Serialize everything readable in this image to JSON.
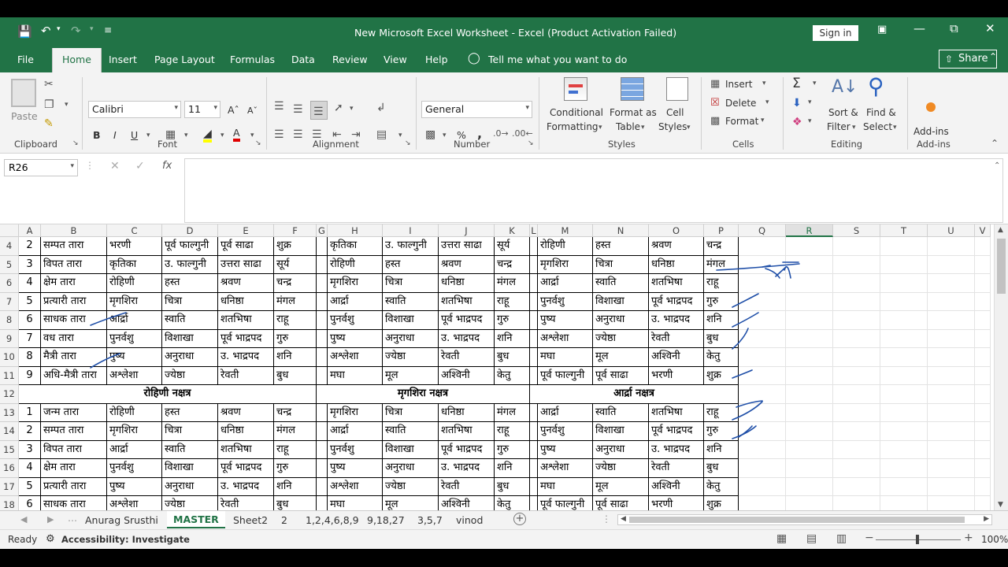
{
  "titlebar": {
    "title": "New Microsoft Excel Worksheet  -  Excel (Product Activation Failed)",
    "signin": "Sign in"
  },
  "tabs": [
    "File",
    "Home",
    "Insert",
    "Page Layout",
    "Formulas",
    "Data",
    "Review",
    "View",
    "Help"
  ],
  "tell_me": "Tell me what you want to do",
  "share": "Share",
  "ribbon": {
    "clipboard": {
      "paste": "Paste",
      "label": "Clipboard"
    },
    "font": {
      "name": "Calibri",
      "size": "11",
      "label": "Font",
      "bold": "B",
      "italic": "I",
      "underline": "U"
    },
    "alignment": {
      "label": "Alignment"
    },
    "number": {
      "format": "General",
      "label": "Number",
      "percent": "%",
      "comma": ","
    },
    "styles": {
      "conditional1": "Conditional",
      "conditional2": "Formatting",
      "format_as1": "Format as",
      "format_as2": "Table",
      "cell_styles1": "Cell",
      "cell_styles2": "Styles",
      "label": "Styles"
    },
    "cells": {
      "insert": "Insert",
      "delete": "Delete",
      "format": "Format",
      "label": "Cells"
    },
    "editing": {
      "sort1": "Sort &",
      "sort2": "Filter",
      "find1": "Find &",
      "find2": "Select",
      "label": "Editing"
    },
    "addins": {
      "button": "Add-ins",
      "label": "Add-ins"
    }
  },
  "namebox": "R26",
  "fx": "fx",
  "columns": [
    {
      "name": "A",
      "w": 28
    },
    {
      "name": "B",
      "w": 84
    },
    {
      "name": "C",
      "w": 70
    },
    {
      "name": "D",
      "w": 71
    },
    {
      "name": "E",
      "w": 71
    },
    {
      "name": "F",
      "w": 54
    },
    {
      "name": "G",
      "w": 14
    },
    {
      "name": "H",
      "w": 70
    },
    {
      "name": "I",
      "w": 71
    },
    {
      "name": "J",
      "w": 71
    },
    {
      "name": "K",
      "w": 45
    },
    {
      "name": "L",
      "w": 10
    },
    {
      "name": "M",
      "w": 70
    },
    {
      "name": "N",
      "w": 71
    },
    {
      "name": "O",
      "w": 70
    },
    {
      "name": "P",
      "w": 44
    },
    {
      "name": "Q",
      "w": 60
    },
    {
      "name": "R",
      "w": 60
    },
    {
      "name": "S",
      "w": 60
    },
    {
      "name": "T",
      "w": 60
    },
    {
      "name": "U",
      "w": 60
    },
    {
      "name": "V",
      "w": 20
    }
  ],
  "selected_column": "R",
  "rows": [
    {
      "n": "4",
      "type": "data",
      "cells": [
        "2",
        "सम्पत तारा",
        "भरणी",
        "पूर्व फाल्गुनी",
        "पूर्व साढा",
        "शुक्र",
        "",
        "कृतिका",
        "उ. फाल्गुनी",
        "उत्तरा साढा",
        "सूर्य",
        "",
        "रोहिणी",
        "हस्त",
        "श्रवण",
        "चन्द्र"
      ]
    },
    {
      "n": "5",
      "type": "data",
      "cells": [
        "3",
        "विपत तारा",
        "कृतिका",
        "उ. फाल्गुनी",
        "उत्तरा साढा",
        "सूर्य",
        "",
        "रोहिणी",
        "हस्त",
        "श्रवण",
        "चन्द्र",
        "",
        "मृगशिरा",
        "चित्रा",
        "धनिष्ठा",
        "मंगल"
      ]
    },
    {
      "n": "6",
      "type": "data",
      "cells": [
        "4",
        "क्षेम तारा",
        "रोहिणी",
        "हस्त",
        "श्रवण",
        "चन्द्र",
        "",
        "मृगशिरा",
        "चित्रा",
        "धनिष्ठा",
        "मंगल",
        "",
        "आर्द्रा",
        "स्वाति",
        "शतभिषा",
        "राहू"
      ]
    },
    {
      "n": "7",
      "type": "data",
      "cells": [
        "5",
        "प्रत्यारी तारा",
        "मृगशिरा",
        "चित्रा",
        "धनिष्ठा",
        "मंगल",
        "",
        "आर्द्रा",
        "स्वाति",
        "शतभिषा",
        "राहू",
        "",
        "पुनर्वशु",
        "विशाखा",
        "पूर्व भाद्रपद",
        "गुरु"
      ]
    },
    {
      "n": "8",
      "type": "data",
      "cells": [
        "6",
        "साधक तारा",
        "आर्द्रा",
        "स्वाति",
        "शतभिषा",
        "राहू",
        "",
        "पुनर्वशु",
        "विशाखा",
        "पूर्व भाद्रपद",
        "गुरु",
        "",
        "पुष्य",
        "अनुराधा",
        "उ. भाद्रपद",
        "शनि"
      ]
    },
    {
      "n": "9",
      "type": "data",
      "cells": [
        "7",
        "वध  तारा",
        "पुनर्वशु",
        "विशाखा",
        "पूर्व भाद्रपद",
        "गुरु",
        "",
        "पुष्य",
        "अनुराधा",
        "उ. भाद्रपद",
        "शनि",
        "",
        "अश्लेशा",
        "ज्येष्ठा",
        "रेवती",
        "बुध"
      ]
    },
    {
      "n": "10",
      "type": "data",
      "cells": [
        "8",
        "मैत्री तारा",
        "पुष्य",
        "अनुराधा",
        "उ. भाद्रपद",
        "शनि",
        "",
        "अश्लेशा",
        "ज्येष्ठा",
        "रेवती",
        "बुध",
        "",
        "मघा",
        "मूल",
        "अश्विनी",
        "केतु"
      ]
    },
    {
      "n": "11",
      "type": "data",
      "cells": [
        "9",
        "अधि-मैत्री तारा",
        "अश्लेशा",
        "ज्येष्ठा",
        "रेवती",
        "बुध",
        "",
        "मघा",
        "मूल",
        "अश्विनी",
        "केतु",
        "",
        "पूर्व फाल्गुनी",
        "पूर्व साढा",
        "भरणी",
        "शुक्र"
      ]
    },
    {
      "n": "12",
      "type": "header",
      "headers": [
        "रोहिणी नक्षत्र",
        "मृगशिरा नक्षत्र",
        "आर्द्रा नक्षत्र"
      ]
    },
    {
      "n": "13",
      "type": "data",
      "cells": [
        "1",
        "जन्म तारा",
        "रोहिणी",
        "हस्त",
        "श्रवण",
        "चन्द्र",
        "",
        "मृगशिरा",
        "चित्रा",
        "धनिष्ठा",
        "मंगल",
        "",
        "आर्द्रा",
        "स्वाति",
        "शतभिषा",
        "राहू"
      ]
    },
    {
      "n": "14",
      "type": "data",
      "cells": [
        "2",
        "सम्पत तारा",
        "मृगशिरा",
        "चित्रा",
        "धनिष्ठा",
        "मंगल",
        "",
        "आर्द्रा",
        "स्वाति",
        "शतभिषा",
        "राहू",
        "",
        "पुनर्वशु",
        "विशाखा",
        "पूर्व भाद्रपद",
        "गुरु"
      ]
    },
    {
      "n": "15",
      "type": "data",
      "cells": [
        "3",
        "विपत तारा",
        "आर्द्रा",
        "स्वाति",
        "शतभिषा",
        "राहू",
        "",
        "पुनर्वशु",
        "विशाखा",
        "पूर्व भाद्रपद",
        "गुरु",
        "",
        "पुष्य",
        "अनुराधा",
        "उ. भाद्रपद",
        "शनि"
      ]
    },
    {
      "n": "16",
      "type": "data",
      "cells": [
        "4",
        "क्षेम तारा",
        "पुनर्वशु",
        "विशाखा",
        "पूर्व भाद्रपद",
        "गुरु",
        "",
        "पुष्य",
        "अनुराधा",
        "उ. भाद्रपद",
        "शनि",
        "",
        "अश्लेशा",
        "ज्येष्ठा",
        "रेवती",
        "बुध"
      ]
    },
    {
      "n": "17",
      "type": "data",
      "cells": [
        "5",
        "प्रत्यारी तारा",
        "पुष्य",
        "अनुराधा",
        "उ. भाद्रपद",
        "शनि",
        "",
        "अश्लेशा",
        "ज्येष्ठा",
        "रेवती",
        "बुध",
        "",
        "मघा",
        "मूल",
        "अश्विनी",
        "केतु"
      ]
    },
    {
      "n": "18",
      "type": "data",
      "cells": [
        "6",
        "साधक तारा",
        "अश्लेशा",
        "ज्येष्ठा",
        "रेवती",
        "बुध",
        "",
        "मघा",
        "मूल",
        "अश्विनी",
        "केतु",
        "",
        "पूर्व फाल्गुनी",
        "पूर्व साढा",
        "भरणी",
        "शुक्र"
      ]
    }
  ],
  "sheets": [
    "Anurag  Srusthi",
    "MASTER",
    "Sheet2",
    "2",
    "1,2,4,6,8,9",
    "9,18,27",
    "3,5,7",
    "vinod"
  ],
  "active_sheet": "MASTER",
  "status": {
    "ready": "Ready",
    "accessibility": "Accessibility: Investigate",
    "zoom": "100%"
  },
  "colors": {
    "excel_green": "#217346",
    "ink": "#1f4fa8"
  }
}
